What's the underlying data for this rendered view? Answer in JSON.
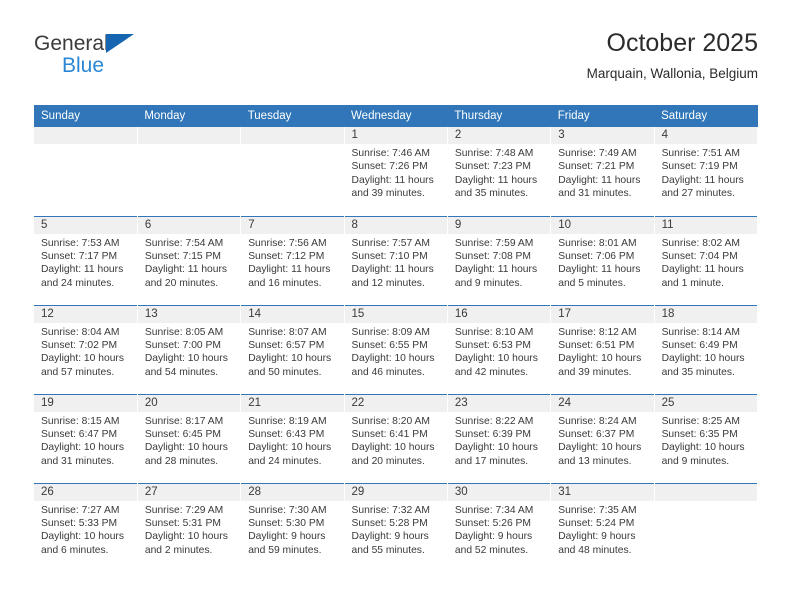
{
  "brand": {
    "name_dark": "General",
    "name_blue": "Blue",
    "triangle_color": "#1565b0",
    "blue_color": "#2b87d6"
  },
  "header": {
    "title": "October 2025",
    "subtitle": "Marquain, Wallonia, Belgium"
  },
  "theme": {
    "header_blue": "#3076b8",
    "daynum_band": "#f0f0f0",
    "text": "#3a3a3a"
  },
  "weekdays": [
    "Sunday",
    "Monday",
    "Tuesday",
    "Wednesday",
    "Thursday",
    "Friday",
    "Saturday"
  ],
  "labels": {
    "sunrise_prefix": "Sunrise:",
    "sunset_prefix": "Sunset:",
    "daylight_prefix": "Daylight:"
  },
  "weeks": [
    [
      {
        "day": "",
        "empty": true
      },
      {
        "day": "",
        "empty": true
      },
      {
        "day": "",
        "empty": true
      },
      {
        "day": "1",
        "sunrise": "Sunrise: 7:46 AM",
        "sunset": "Sunset: 7:26 PM",
        "daylight": "Daylight: 11 hours and 39 minutes."
      },
      {
        "day": "2",
        "sunrise": "Sunrise: 7:48 AM",
        "sunset": "Sunset: 7:23 PM",
        "daylight": "Daylight: 11 hours and 35 minutes."
      },
      {
        "day": "3",
        "sunrise": "Sunrise: 7:49 AM",
        "sunset": "Sunset: 7:21 PM",
        "daylight": "Daylight: 11 hours and 31 minutes."
      },
      {
        "day": "4",
        "sunrise": "Sunrise: 7:51 AM",
        "sunset": "Sunset: 7:19 PM",
        "daylight": "Daylight: 11 hours and 27 minutes."
      }
    ],
    [
      {
        "day": "5",
        "sunrise": "Sunrise: 7:53 AM",
        "sunset": "Sunset: 7:17 PM",
        "daylight": "Daylight: 11 hours and 24 minutes."
      },
      {
        "day": "6",
        "sunrise": "Sunrise: 7:54 AM",
        "sunset": "Sunset: 7:15 PM",
        "daylight": "Daylight: 11 hours and 20 minutes."
      },
      {
        "day": "7",
        "sunrise": "Sunrise: 7:56 AM",
        "sunset": "Sunset: 7:12 PM",
        "daylight": "Daylight: 11 hours and 16 minutes."
      },
      {
        "day": "8",
        "sunrise": "Sunrise: 7:57 AM",
        "sunset": "Sunset: 7:10 PM",
        "daylight": "Daylight: 11 hours and 12 minutes."
      },
      {
        "day": "9",
        "sunrise": "Sunrise: 7:59 AM",
        "sunset": "Sunset: 7:08 PM",
        "daylight": "Daylight: 11 hours and 9 minutes."
      },
      {
        "day": "10",
        "sunrise": "Sunrise: 8:01 AM",
        "sunset": "Sunset: 7:06 PM",
        "daylight": "Daylight: 11 hours and 5 minutes."
      },
      {
        "day": "11",
        "sunrise": "Sunrise: 8:02 AM",
        "sunset": "Sunset: 7:04 PM",
        "daylight": "Daylight: 11 hours and 1 minute."
      }
    ],
    [
      {
        "day": "12",
        "sunrise": "Sunrise: 8:04 AM",
        "sunset": "Sunset: 7:02 PM",
        "daylight": "Daylight: 10 hours and 57 minutes."
      },
      {
        "day": "13",
        "sunrise": "Sunrise: 8:05 AM",
        "sunset": "Sunset: 7:00 PM",
        "daylight": "Daylight: 10 hours and 54 minutes."
      },
      {
        "day": "14",
        "sunrise": "Sunrise: 8:07 AM",
        "sunset": "Sunset: 6:57 PM",
        "daylight": "Daylight: 10 hours and 50 minutes."
      },
      {
        "day": "15",
        "sunrise": "Sunrise: 8:09 AM",
        "sunset": "Sunset: 6:55 PM",
        "daylight": "Daylight: 10 hours and 46 minutes."
      },
      {
        "day": "16",
        "sunrise": "Sunrise: 8:10 AM",
        "sunset": "Sunset: 6:53 PM",
        "daylight": "Daylight: 10 hours and 42 minutes."
      },
      {
        "day": "17",
        "sunrise": "Sunrise: 8:12 AM",
        "sunset": "Sunset: 6:51 PM",
        "daylight": "Daylight: 10 hours and 39 minutes."
      },
      {
        "day": "18",
        "sunrise": "Sunrise: 8:14 AM",
        "sunset": "Sunset: 6:49 PM",
        "daylight": "Daylight: 10 hours and 35 minutes."
      }
    ],
    [
      {
        "day": "19",
        "sunrise": "Sunrise: 8:15 AM",
        "sunset": "Sunset: 6:47 PM",
        "daylight": "Daylight: 10 hours and 31 minutes."
      },
      {
        "day": "20",
        "sunrise": "Sunrise: 8:17 AM",
        "sunset": "Sunset: 6:45 PM",
        "daylight": "Daylight: 10 hours and 28 minutes."
      },
      {
        "day": "21",
        "sunrise": "Sunrise: 8:19 AM",
        "sunset": "Sunset: 6:43 PM",
        "daylight": "Daylight: 10 hours and 24 minutes."
      },
      {
        "day": "22",
        "sunrise": "Sunrise: 8:20 AM",
        "sunset": "Sunset: 6:41 PM",
        "daylight": "Daylight: 10 hours and 20 minutes."
      },
      {
        "day": "23",
        "sunrise": "Sunrise: 8:22 AM",
        "sunset": "Sunset: 6:39 PM",
        "daylight": "Daylight: 10 hours and 17 minutes."
      },
      {
        "day": "24",
        "sunrise": "Sunrise: 8:24 AM",
        "sunset": "Sunset: 6:37 PM",
        "daylight": "Daylight: 10 hours and 13 minutes."
      },
      {
        "day": "25",
        "sunrise": "Sunrise: 8:25 AM",
        "sunset": "Sunset: 6:35 PM",
        "daylight": "Daylight: 10 hours and 9 minutes."
      }
    ],
    [
      {
        "day": "26",
        "sunrise": "Sunrise: 7:27 AM",
        "sunset": "Sunset: 5:33 PM",
        "daylight": "Daylight: 10 hours and 6 minutes."
      },
      {
        "day": "27",
        "sunrise": "Sunrise: 7:29 AM",
        "sunset": "Sunset: 5:31 PM",
        "daylight": "Daylight: 10 hours and 2 minutes."
      },
      {
        "day": "28",
        "sunrise": "Sunrise: 7:30 AM",
        "sunset": "Sunset: 5:30 PM",
        "daylight": "Daylight: 9 hours and 59 minutes."
      },
      {
        "day": "29",
        "sunrise": "Sunrise: 7:32 AM",
        "sunset": "Sunset: 5:28 PM",
        "daylight": "Daylight: 9 hours and 55 minutes."
      },
      {
        "day": "30",
        "sunrise": "Sunrise: 7:34 AM",
        "sunset": "Sunset: 5:26 PM",
        "daylight": "Daylight: 9 hours and 52 minutes."
      },
      {
        "day": "31",
        "sunrise": "Sunrise: 7:35 AM",
        "sunset": "Sunset: 5:24 PM",
        "daylight": "Daylight: 9 hours and 48 minutes."
      },
      {
        "day": "",
        "empty": true
      }
    ]
  ]
}
